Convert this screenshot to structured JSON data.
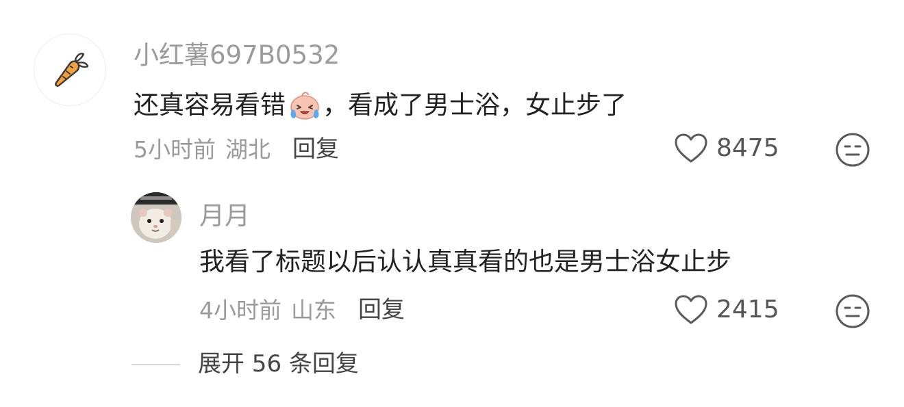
{
  "comment": {
    "username": "小红薯697B0532",
    "avatar_icon": "carrot-icon",
    "text_before_emoji": "还真容易看错",
    "emoji": "crying-laughing-emoji",
    "text_after_emoji": "，看成了男士浴，女止步了",
    "time": "5小时前",
    "location": "湖北",
    "reply_label": "回复",
    "like_count": "8475"
  },
  "reply": {
    "username": "月月",
    "avatar_icon": "hamster-avatar",
    "text": "我看了标题以后认认真真看的也是男士浴女止步",
    "time": "4小时前",
    "location": "山东",
    "reply_label": "回复",
    "like_count": "2415"
  },
  "expand": {
    "label": "展开 56 条回复"
  },
  "colors": {
    "text_primary": "#222222",
    "text_secondary": "#9a9a9a",
    "carrot_orange": "#f2a03d"
  }
}
